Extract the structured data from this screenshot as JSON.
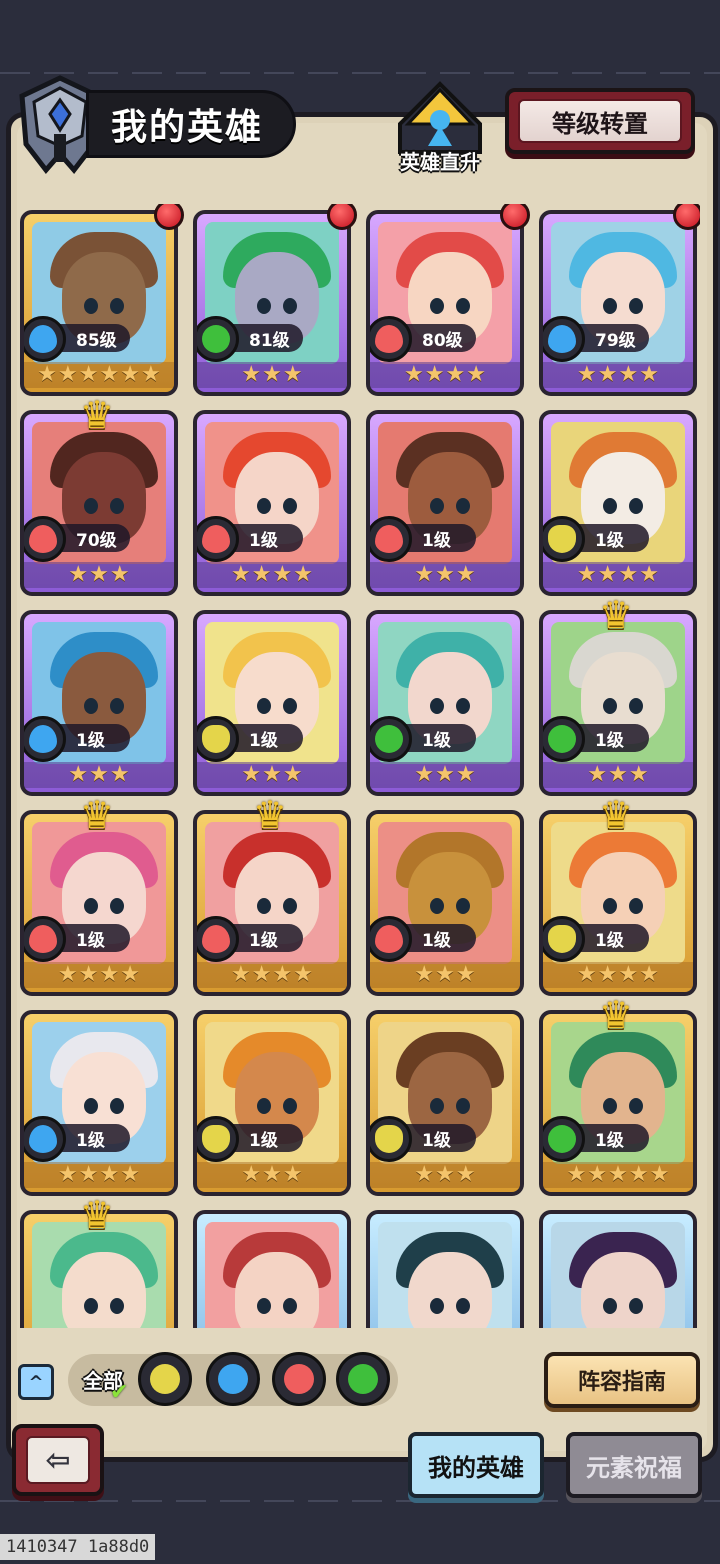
{
  "header": {
    "title": "我的英雄",
    "levelup_label": "英雄直升",
    "reset_button": "等级转置"
  },
  "colors": {
    "water": "#3ea6f0",
    "fire": "#ef5e5e",
    "wood": "#3fbf3c",
    "earth": "#e4d54a",
    "rarity_gold": "#f6cf6a",
    "rarity_purple": "#b787f0",
    "rarity_blue": "#9fd2f2"
  },
  "heroes": [
    {
      "level": "85级",
      "element": "water",
      "stars": 6,
      "rarity": "gold",
      "red_dot": true,
      "crown": false,
      "skin": "#8f6a4a",
      "hair": "#7a5236",
      "bg": "#8fcbe6"
    },
    {
      "level": "81级",
      "element": "wood",
      "stars": 3,
      "rarity": "purple",
      "red_dot": true,
      "crown": false,
      "skin": "#a9a9c4",
      "hair": "#2eaa5e",
      "bg": "#7ed1c4"
    },
    {
      "level": "80级",
      "element": "fire",
      "stars": 4,
      "rarity": "purple",
      "red_dot": true,
      "crown": false,
      "skin": "#f7d6c2",
      "hair": "#e24b48",
      "bg": "#f4a0a8"
    },
    {
      "level": "79级",
      "element": "water",
      "stars": 4,
      "rarity": "purple",
      "red_dot": true,
      "crown": false,
      "skin": "#f5dcd0",
      "hair": "#4fb8e2",
      "bg": "#9fd2e6"
    },
    {
      "level": "70级",
      "element": "fire",
      "stars": 3,
      "rarity": "purple",
      "red_dot": false,
      "crown": true,
      "skin": "#7c3b33",
      "hair": "#51261f",
      "bg": "#e67f7a"
    },
    {
      "level": "1级",
      "element": "fire",
      "stars": 4,
      "rarity": "purple",
      "red_dot": false,
      "crown": false,
      "skin": "#f5d5c8",
      "hair": "#e5482f",
      "bg": "#f0928a"
    },
    {
      "level": "1级",
      "element": "fire",
      "stars": 3,
      "rarity": "purple",
      "red_dot": false,
      "crown": false,
      "skin": "#9d5c3e",
      "hair": "#5b3022",
      "bg": "#e57a70"
    },
    {
      "level": "1级",
      "element": "earth",
      "stars": 4,
      "rarity": "purple",
      "red_dot": false,
      "crown": false,
      "skin": "#f3ece4",
      "hair": "#e07a34",
      "bg": "#e9d57a"
    },
    {
      "level": "1级",
      "element": "water",
      "stars": 3,
      "rarity": "purple",
      "red_dot": false,
      "crown": false,
      "skin": "#8a5a3e",
      "hair": "#2e8ec8",
      "bg": "#7fc3e8"
    },
    {
      "level": "1级",
      "element": "earth",
      "stars": 3,
      "rarity": "purple",
      "red_dot": false,
      "crown": false,
      "skin": "#f7dccc",
      "hair": "#f2c34c",
      "bg": "#f0e38c"
    },
    {
      "level": "1级",
      "element": "wood",
      "stars": 3,
      "rarity": "purple",
      "red_dot": false,
      "crown": false,
      "skin": "#f2d7cd",
      "hair": "#3fb1a8",
      "bg": "#8fd6c2"
    },
    {
      "level": "1级",
      "element": "wood",
      "stars": 3,
      "rarity": "purple",
      "red_dot": false,
      "crown": true,
      "skin": "#e8ddd0",
      "hair": "#d9d7d0",
      "bg": "#9ed48a"
    },
    {
      "level": "1级",
      "element": "fire",
      "stars": 4,
      "rarity": "gold",
      "red_dot": false,
      "crown": true,
      "skin": "#f5d7cf",
      "hair": "#e05c8f",
      "bg": "#f09898"
    },
    {
      "level": "1级",
      "element": "fire",
      "stars": 4,
      "rarity": "gold",
      "red_dot": false,
      "crown": true,
      "skin": "#f5d5c8",
      "hair": "#c8302c",
      "bg": "#f0a0a0"
    },
    {
      "level": "1级",
      "element": "fire",
      "stars": 3,
      "rarity": "gold",
      "red_dot": false,
      "crown": false,
      "skin": "#c8913c",
      "hair": "#b2762a",
      "bg": "#ec8f86"
    },
    {
      "level": "1级",
      "element": "earth",
      "stars": 4,
      "rarity": "gold",
      "red_dot": false,
      "crown": true,
      "skin": "#f5d0b6",
      "hair": "#ec7a36",
      "bg": "#eedb8a"
    },
    {
      "level": "1级",
      "element": "water",
      "stars": 4,
      "rarity": "gold",
      "red_dot": false,
      "crown": false,
      "skin": "#f8e0d4",
      "hair": "#e8e8ee",
      "bg": "#9cd0ec"
    },
    {
      "level": "1级",
      "element": "earth",
      "stars": 3,
      "rarity": "gold",
      "red_dot": false,
      "crown": false,
      "skin": "#d4884c",
      "hair": "#e58a2a",
      "bg": "#f0d98a"
    },
    {
      "level": "1级",
      "element": "earth",
      "stars": 3,
      "rarity": "gold",
      "red_dot": false,
      "crown": false,
      "skin": "#9c6642",
      "hair": "#6a3e22",
      "bg": "#eed488"
    },
    {
      "level": "1级",
      "element": "wood",
      "stars": 5,
      "rarity": "gold",
      "red_dot": false,
      "crown": true,
      "skin": "#e2b48e",
      "hair": "#2f8a5a",
      "bg": "#a8d68c"
    },
    {
      "level": "",
      "element": "wood",
      "stars": 0,
      "rarity": "gold",
      "red_dot": false,
      "crown": true,
      "skin": "#f4dccc",
      "hair": "#4bb98c",
      "bg": "#a9dcae"
    },
    {
      "level": "",
      "element": "fire",
      "stars": 0,
      "rarity": "blue",
      "red_dot": false,
      "crown": false,
      "skin": "#f4d3c4",
      "hair": "#b83a3a",
      "bg": "#f2a0a0"
    },
    {
      "level": "",
      "element": "water",
      "stars": 0,
      "rarity": "blue",
      "red_dot": false,
      "crown": false,
      "skin": "#f1d8cc",
      "hair": "#1f3f4a",
      "bg": "#bfe0ee"
    },
    {
      "level": "",
      "element": "wood",
      "stars": 0,
      "rarity": "blue",
      "red_dot": false,
      "crown": false,
      "skin": "#eed4ca",
      "hair": "#3a2450",
      "bg": "#b8d7e8"
    }
  ],
  "filters": {
    "all_label": "全部",
    "elements": [
      "earth",
      "water",
      "fire",
      "wood"
    ]
  },
  "guide_button": "阵容指南",
  "tabs": {
    "active": "我的英雄",
    "inactive": "元素祝福"
  },
  "debug_text": "1410347 1a88d0"
}
